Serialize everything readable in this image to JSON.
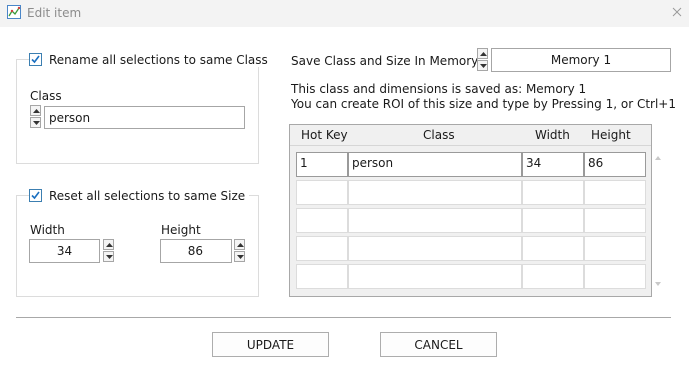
{
  "window": {
    "title": "Edit item",
    "app_icon": "graph-app-icon",
    "close_icon": "close-icon"
  },
  "rename_group": {
    "checked": true,
    "label": "Rename all selections to same Class",
    "class_label": "Class",
    "class_value": "person"
  },
  "resize_group": {
    "checked": true,
    "label": "Reset all selections to same Size",
    "width_label": "Width",
    "width_value": "34",
    "height_label": "Height",
    "height_value": "86"
  },
  "memory": {
    "label": "Save Class and Size In Memory",
    "value": "Memory 1",
    "info_line1": "This class and dimensions is saved as: Memory 1",
    "info_line2": "You can create ROI of this size and type by Pressing 1, or Ctrl+1"
  },
  "table": {
    "headers": [
      "Hot Key",
      "Class",
      "Width",
      "Height"
    ],
    "rows": [
      [
        "1",
        "person",
        "34",
        "86"
      ],
      [
        "",
        "",
        "",
        ""
      ],
      [
        "",
        "",
        "",
        ""
      ],
      [
        "",
        "",
        "",
        ""
      ],
      [
        "",
        "",
        "",
        ""
      ]
    ]
  },
  "buttons": {
    "update": "UPDATE",
    "cancel": "CANCEL"
  },
  "colors": {
    "checkbox_accent": "#1a6fc0",
    "border": "#a6a6a6",
    "titlebar": "#f3f3f3"
  }
}
